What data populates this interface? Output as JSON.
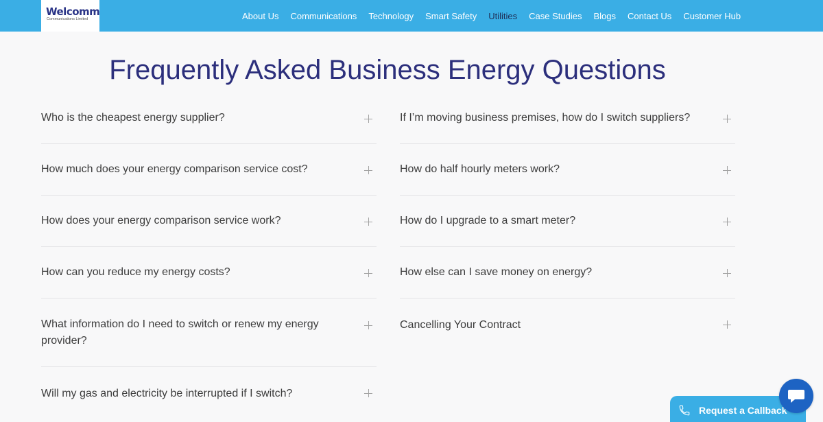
{
  "brand": {
    "name": "Welcomm",
    "tagline": "Communications Limited"
  },
  "nav": {
    "items": [
      "About Us",
      "Communications",
      "Technology",
      "Smart Safety",
      "Utilities",
      "Case Studies",
      "Blogs",
      "Contact Us",
      "Customer Hub"
    ],
    "active": "Utilities"
  },
  "page": {
    "title": "Frequently Asked Business Energy Questions"
  },
  "faq": {
    "left": [
      "Who is the cheapest energy supplier?",
      "How much does your energy comparison service cost?",
      "How does your energy comparison service work?",
      "How can you reduce my energy costs?",
      "What information do I need to switch or renew my energy provider?",
      "Will my gas and electricity be interrupted if I switch?"
    ],
    "right": [
      "If I’m moving business premises, how do I switch suppliers?",
      "How do half hourly meters work?",
      "How do I upgrade to a smart meter?",
      "How else can I save money on energy?",
      "Cancelling Your Contract"
    ]
  },
  "widgets": {
    "callback_label": "Request a Callback"
  },
  "colors": {
    "header": "#3aaee5",
    "title": "#2c2f7c",
    "chat": "#1d63c3"
  }
}
